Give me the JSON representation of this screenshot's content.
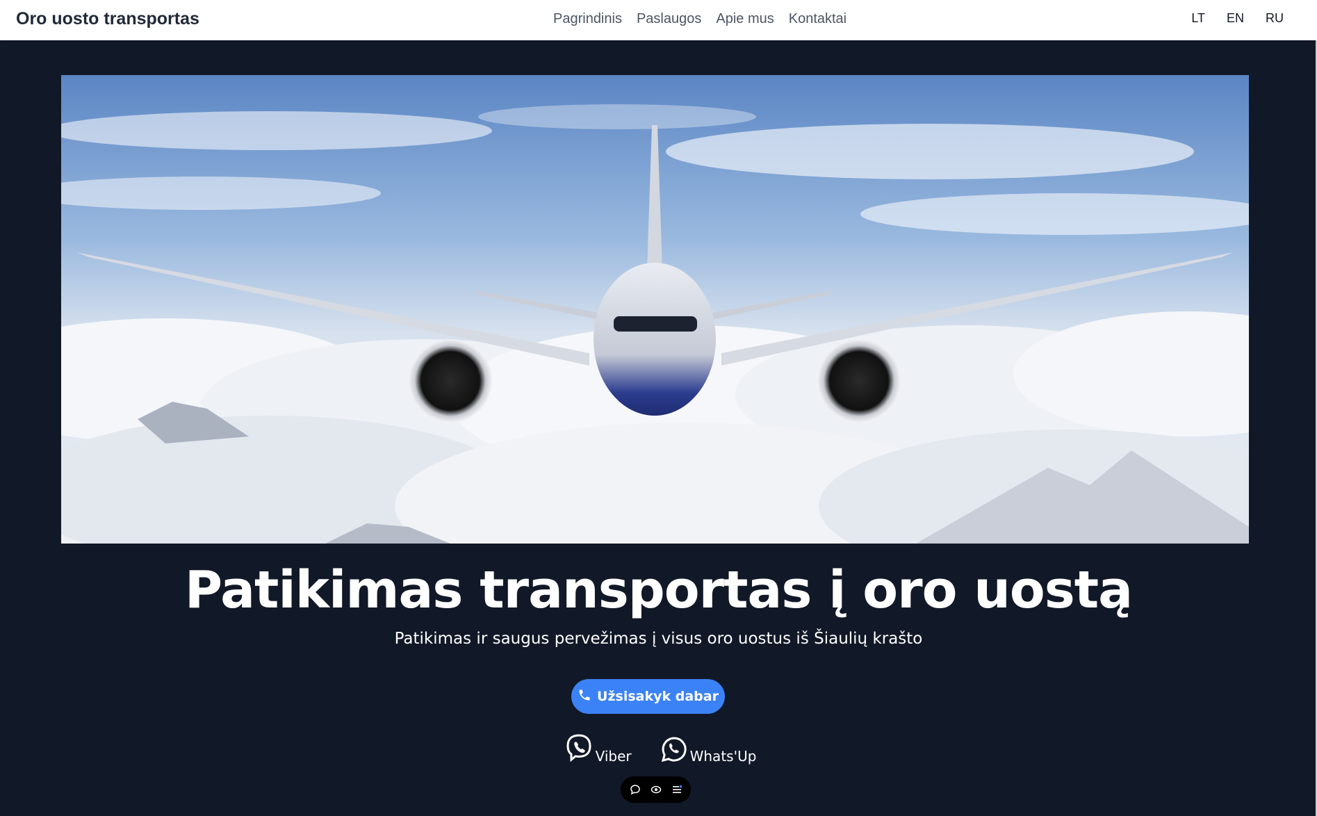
{
  "navbar": {
    "brand": "Oro uosto transportas",
    "links": [
      "Pagrindinis",
      "Paslaugos",
      "Apie mus",
      "Kontaktai"
    ],
    "languages": [
      "LT",
      "EN",
      "RU"
    ]
  },
  "hero": {
    "image_icon": "airplane-over-clouds-photo",
    "title": "Patikimas transportas į oro uostą",
    "subtitle": "Patikimas ir saugus pervežimas į visus oro uostus iš Šiaulių krašto",
    "cta_label": "Užsisakyk dabar",
    "cta_icon": "phone-icon"
  },
  "social": {
    "viber_label": "Viber",
    "viber_icon": "viber-icon",
    "whatsapp_label": "Whats'Up",
    "whatsapp_icon": "whatsapp-icon"
  },
  "widget": {
    "icons": [
      "chat-bubble-icon",
      "eye-icon",
      "menu-list-icon"
    ]
  },
  "colors": {
    "page_background": "#111827",
    "navbar_background": "#ffffff",
    "accent": "#3b82f6",
    "text_light": "#ffffff"
  }
}
